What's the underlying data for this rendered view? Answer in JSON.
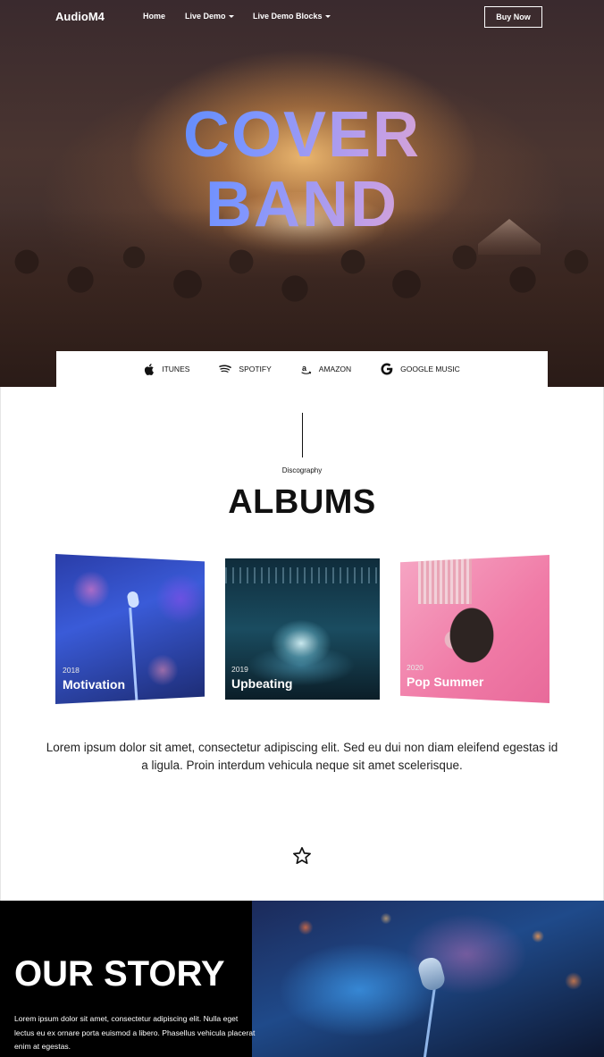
{
  "nav": {
    "brand": "AudioM4",
    "links": [
      {
        "label": "Home"
      },
      {
        "label": "Live Demo"
      },
      {
        "label": "Live Demo Blocks"
      }
    ],
    "buy_label": "Buy Now"
  },
  "hero": {
    "title_line1": "COVER",
    "title_line2": "BAND"
  },
  "streaming": [
    {
      "label": "ITUNES",
      "icon": "apple-icon"
    },
    {
      "label": "SPOTIFY",
      "icon": "spotify-icon"
    },
    {
      "label": "AMAZON",
      "icon": "amazon-icon"
    },
    {
      "label": "GOOGLE MUSIC",
      "icon": "google-icon"
    }
  ],
  "albums_section": {
    "eyebrow": "Discography",
    "title": "ALBUMS",
    "albums": [
      {
        "year": "2018",
        "name": "Motivation"
      },
      {
        "year": "2019",
        "name": "Upbeating"
      },
      {
        "year": "2020",
        "name": "Pop Summer"
      }
    ],
    "description": "Lorem ipsum dolor sit amet, consectetur adipiscing elit. Sed eu dui non diam eleifend egestas id a ligula. Proin interdum vehicula neque sit amet scelerisque."
  },
  "story": {
    "title": "OUR STORY",
    "text": "Lorem ipsum dolor sit amet, consectetur adipiscing elit. Nulla eget lectus eu ex ornare porta euismod a libero. Phasellus vehicula placerat enim at egestas."
  }
}
